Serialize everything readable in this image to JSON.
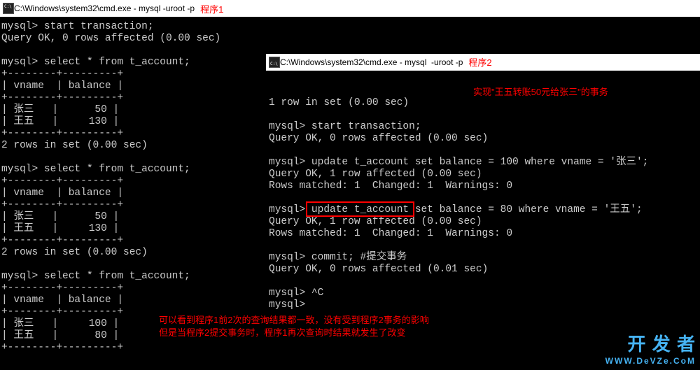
{
  "window1": {
    "title": "C:\\Windows\\system32\\cmd.exe - mysql  -uroot -p",
    "label": "程序1"
  },
  "window2": {
    "title": "C:\\Windows\\system32\\cmd.exe - mysql  -uroot -p",
    "label": "程序2"
  },
  "left_terminal": "mysql> start transaction;\nQuery OK, 0 rows affected (0.00 sec)\n\nmysql> select * from t_account;\n+--------+---------+\n| vname  | balance |\n+--------+---------+\n| 张三   |      50 |\n| 王五   |     130 |\n+--------+---------+\n2 rows in set (0.00 sec)\n\nmysql> select * from t_account;\n+--------+---------+\n| vname  | balance |\n+--------+---------+\n| 张三   |      50 |\n| 王五   |     130 |\n+--------+---------+\n2 rows in set (0.00 sec)\n\nmysql> select * from t_account;\n+--------+---------+\n| vname  | balance |\n+--------+---------+\n| 张三   |     100 |\n| 王五   |      80 |\n+--------+---------+",
  "right_terminal": "1 row in set (0.00 sec)\n\nmysql> start transaction;\nQuery OK, 0 rows affected (0.00 sec)\n\nmysql> update t_account set balance = 100 where vname = '张三';\nQuery OK, 1 row affected (0.00 sec)\nRows matched: 1  Changed: 1  Warnings: 0\n\nmysql> update t_account set balance = 80 where vname = '王五';\nQuery OK, 1 row affected (0.00 sec)\nRows matched: 1  Changed: 1  Warnings: 0\n\nmysql> commit; #提交事务\nQuery OK, 0 rows affected (0.01 sec)\n\nmysql> ^C\nmysql>",
  "annotation_top": "实现\"王五转账50元给张三\"的事务",
  "annotation_bottom_line1": "可以看到程序1前2次的查询结果都一致，没有受到程序2事务的影响",
  "annotation_bottom_line2": "但是当程序2提交事务时，程序1再次查询时结果就发生了改变",
  "watermark_zh": "开 发 者",
  "watermark_en": "WWW.DeVZe.CoM"
}
